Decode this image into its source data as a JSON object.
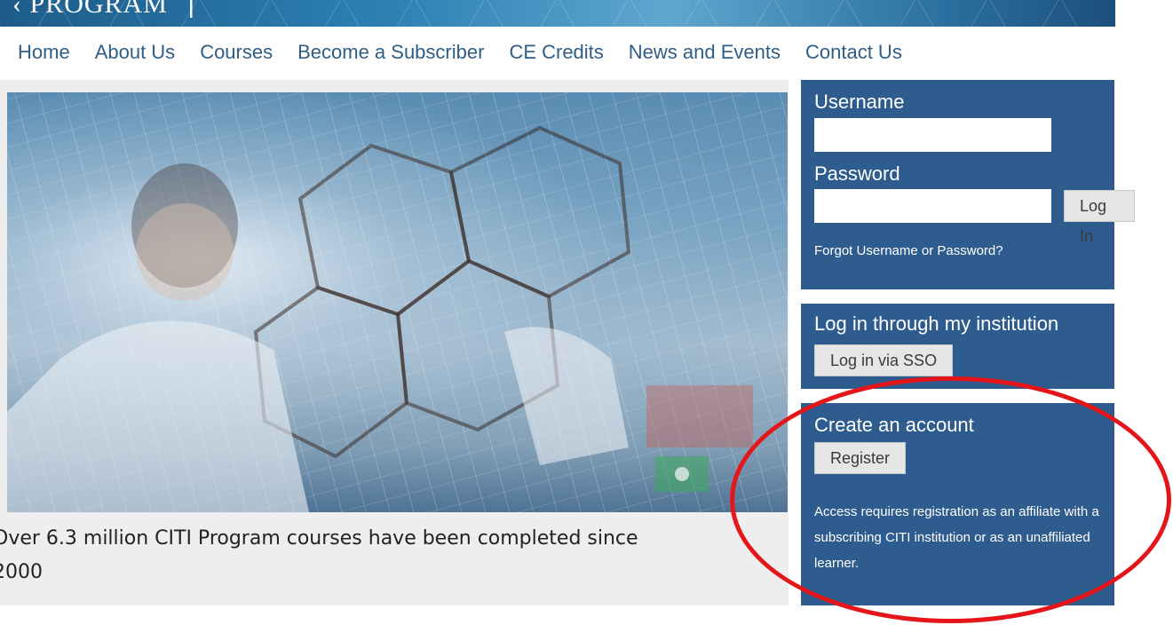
{
  "header": {
    "logo_text": "PROGRAM",
    "logo_mark": "|"
  },
  "nav": {
    "items": [
      "Home",
      "About Us",
      "Courses",
      "Become a Subscriber",
      "CE Credits",
      "News and Events",
      "Contact Us"
    ]
  },
  "hero": {
    "caption_line1": "Over 6.3 million CITI Program courses have been completed since",
    "caption_line2": "2000"
  },
  "login": {
    "username_label": "Username",
    "username_value": "",
    "password_label": "Password",
    "password_value": "",
    "login_button": "Log In",
    "forgot_link": "Forgot Username or Password?"
  },
  "sso": {
    "heading": "Log in through my institution",
    "button": "Log in via SSO"
  },
  "create": {
    "heading": "Create an account",
    "button": "Register",
    "info_lines": [
      "Access requires registration as an affiliate with a",
      "subscribing CITI institution or as an unaffiliated",
      "learner."
    ]
  },
  "colors": {
    "panel_bg": "#2e5c8e",
    "nav_link": "#2f5d86",
    "annotation": "#e4161a"
  }
}
